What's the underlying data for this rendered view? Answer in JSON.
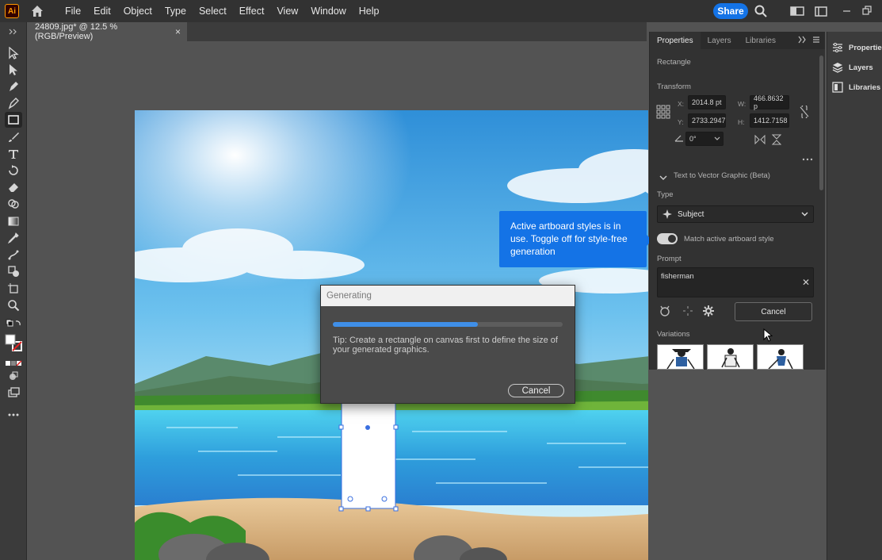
{
  "app": {
    "logo": "Ai",
    "menu": [
      "File",
      "Edit",
      "Object",
      "Type",
      "Select",
      "Effect",
      "View",
      "Window",
      "Help"
    ],
    "share_label": "Share"
  },
  "document": {
    "tab_title": "24809.jpg* @ 12.5 % (RGB/Preview)",
    "close_glyph": "×"
  },
  "callout": {
    "text": "Active artboard styles is in use. Toggle off for style-free generation"
  },
  "generating_dialog": {
    "title": "Generating",
    "progress": 0.63,
    "tip": "Tip: Create a rectangle on canvas first to define the size of your generated graphics.",
    "cancel_label": "Cancel"
  },
  "properties_panel": {
    "tabs": [
      "Properties",
      "Layers",
      "Libraries"
    ],
    "active_tab": "Properties",
    "object_type": "Rectangle",
    "transform_heading": "Transform",
    "x_label": "X:",
    "x_value": "2014.8 pt",
    "y_label": "Y:",
    "y_value": "2733.2947",
    "w_label": "W:",
    "w_value": "466.8632 p",
    "h_label": "H:",
    "h_value": "1412.7158",
    "angle_value": "0°",
    "section_title": "Text to Vector Graphic (Beta)",
    "type_heading": "Type",
    "type_value": "Subject",
    "match_style_label": "Match active artboard style",
    "match_style_on": true,
    "prompt_heading": "Prompt",
    "prompt_value": "fisherman",
    "cancel_label": "Cancel",
    "variations_heading": "Variations"
  },
  "dock": {
    "items": [
      "Properties",
      "Layers",
      "Libraries"
    ]
  },
  "colors": {
    "accent": "#1473e6",
    "panel_bg": "#323232",
    "chrome_bg": "#3b3b3b"
  }
}
